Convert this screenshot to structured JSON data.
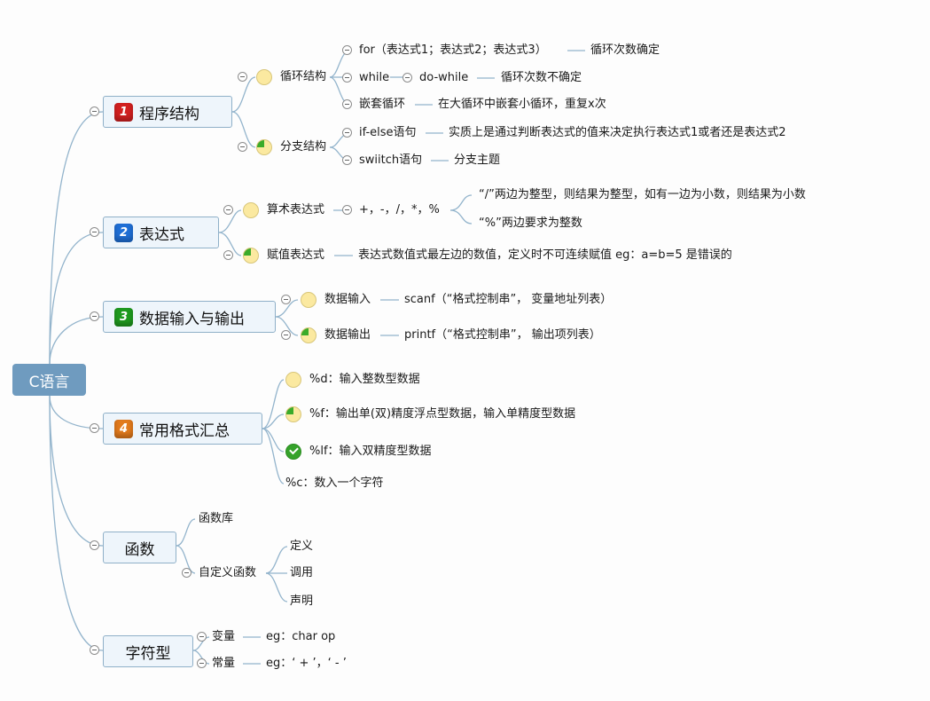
{
  "root": "C语言",
  "colors": {
    "root": "#6f9bbf",
    "line": "#93b4cc",
    "badge1": "#d22020",
    "badge2": "#1f6fd6",
    "badge3": "#1f9a1f",
    "badge4": "#e27a1c",
    "progress_fill": "#3bab2a",
    "progress_empty": "#fbe9a0"
  },
  "branches": {
    "b1": {
      "num": "1",
      "label": "程序结构"
    },
    "b2": {
      "num": "2",
      "label": "表达式"
    },
    "b3": {
      "num": "3",
      "label": "数据输入与输出"
    },
    "b4": {
      "num": "4",
      "label": "常用格式汇总"
    },
    "b5": {
      "label": "函数"
    },
    "b6": {
      "label": "字符型"
    }
  },
  "n": {
    "loop": "循环结构",
    "for": "for（表达式1；表达式2；表达式3）",
    "for_note": "循环次数确定",
    "while": "while",
    "dowhile": "do-while",
    "while_note": "循环次数不确定",
    "nested": "嵌套循环",
    "nested_note": "在大循环中嵌套小循环，重复x次",
    "branch": "分支结构",
    "ifelse": "if-else语句",
    "ifelse_note": "实质上是通过判断表达式的值来决定执行表达式1或者还是表达式2",
    "switch": "swiitch语句",
    "switch_note": "分支主题",
    "arith": "算术表达式",
    "ops": "+，-，/，*，%",
    "div_note": "“/”两边为整型，则结果为整型，如有一边为小数，则结果为小数",
    "mod_note": "“%”两边要求为整数",
    "assign": "赋值表达式",
    "assign_note": "表达式数值式最左边的数值，定义时不可连续赋值   eg：a=b=5 是错误的",
    "input": "数据输入",
    "scanf": "scanf（“格式控制串”， 变量地址列表）",
    "output": "数据输出",
    "printf": "printf（“格式控制串”， 输出项列表）",
    "fmt_d": "%d：输入整数型数据",
    "fmt_f": "%f：输出单(双)精度浮点型数据，输入单精度型数据",
    "fmt_lf": "%lf：输入双精度型数据",
    "fmt_c": "%c：数入一个字符",
    "lib": "函数库",
    "custom": "自定义函数",
    "define": "定义",
    "call": "调用",
    "declare": "声明",
    "var": "变量",
    "var_eg": "eg：char op",
    "const": "常量",
    "const_eg": "eg：‘ + ’，‘ - ’"
  },
  "progress": {
    "loop": 0,
    "branch": 0.25,
    "arith": 0,
    "assign": 0.25,
    "input": 0,
    "output": 0.25,
    "fmt_d": 0,
    "fmt_f": 0.25,
    "fmt_lf": 1
  }
}
